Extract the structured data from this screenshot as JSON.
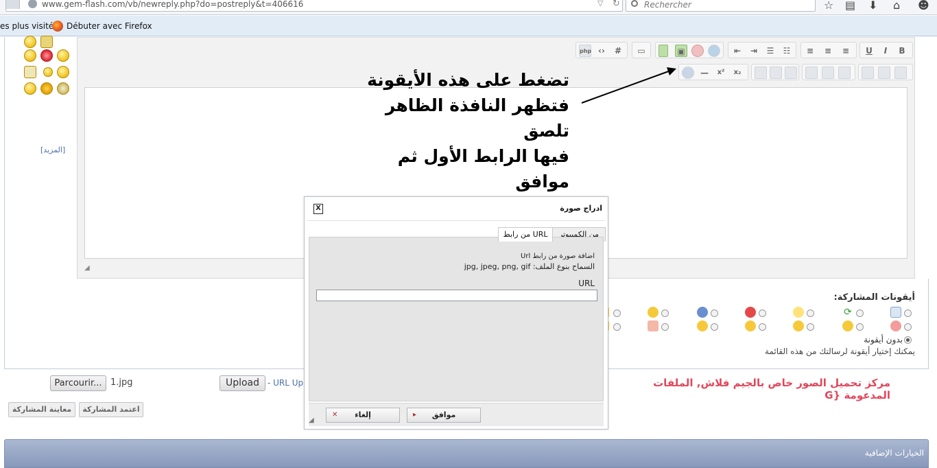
{
  "browser": {
    "url": "www.gem-flash.com/vb/newreply.php?do=postreply&t=406616",
    "search_placeholder": "Rechercher",
    "bookmarks": [
      "es plus visités",
      "Débuter avec Firefox"
    ]
  },
  "editor": {
    "more_link": "[المزيد]"
  },
  "instruction": {
    "lines": [
      "تضغط على هذه الأيقونة",
      "فتظهر النافذة الظاهر تلصق",
      "فيها الرابط الأول ثم موافق"
    ]
  },
  "post_icons": {
    "title": "أيقونات المشاركة:",
    "no_icon_label": "بدون أيقونة",
    "hint": "يمكنك إختيار أيقونة لرسالتك من هذه القائمة"
  },
  "upload": {
    "browse_label": "Parcourir...",
    "file_name": "1.jpg",
    "upload_label": "Upload",
    "url_link": "- URL Up",
    "center_text": "مركز تحميل الصور خاص بالجيم فلاش, الملفات المدعومة {G"
  },
  "actions": {
    "submit_label": "اعتمد المشاركة",
    "preview_label": "معاينة المشاركة"
  },
  "extra_options": {
    "title": "الخيارات الإضافية"
  },
  "dialog": {
    "title": "ادراج صورة",
    "close_label": "X",
    "tabs": [
      {
        "label": "من الكمبيوتر",
        "active": false
      },
      {
        "label": "من رابط URL",
        "active": true
      }
    ],
    "line1": "اضافة صورة من رابط Url",
    "line2": "السماح بنوع الملف: jpg, jpeg, png, gif",
    "url_label": "URL",
    "url_value": "",
    "ok_label": "موافق",
    "cancel_label": "إلغاء"
  }
}
